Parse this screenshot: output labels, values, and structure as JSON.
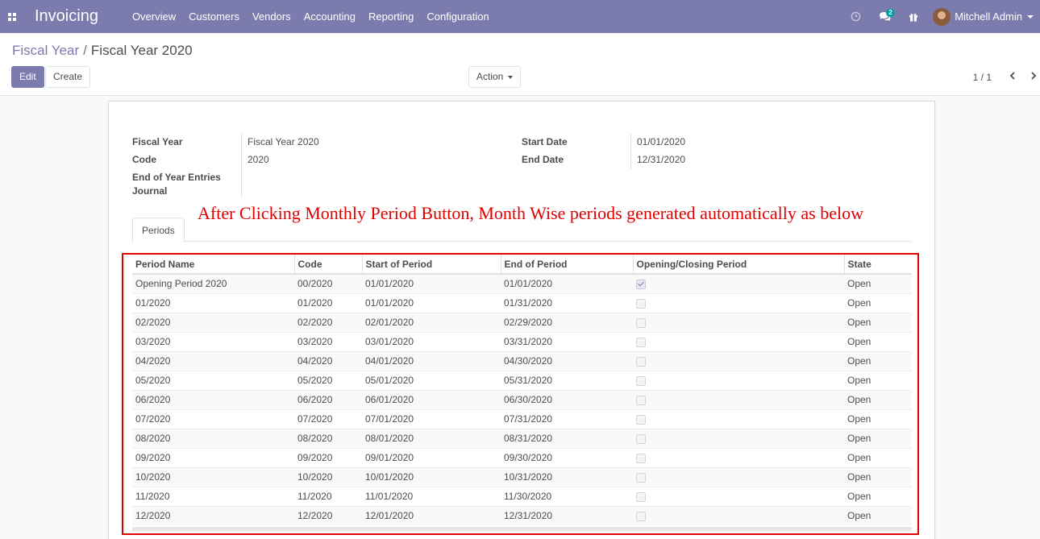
{
  "navbar": {
    "app_title": "Invoicing",
    "menu": [
      "Overview",
      "Customers",
      "Vendors",
      "Accounting",
      "Reporting",
      "Configuration"
    ],
    "messages_badge": "2",
    "user_name": "Mitchell Admin",
    "color": "#7c7bad"
  },
  "breadcrumb": {
    "parent": "Fiscal Year",
    "current": "Fiscal Year 2020"
  },
  "buttons": {
    "edit": "Edit",
    "create": "Create",
    "action": "Action"
  },
  "pager": {
    "text": "1 / 1"
  },
  "form": {
    "fiscal_year_label": "Fiscal Year",
    "fiscal_year_value": "Fiscal Year 2020",
    "code_label": "Code",
    "code_value": "2020",
    "end_entries_label_1": "End of Year Entries",
    "end_entries_label_2": "Journal",
    "start_date_label": "Start Date",
    "start_date_value": "01/01/2020",
    "end_date_label": "End Date",
    "end_date_value": "12/31/2020"
  },
  "annotation": "After Clicking Monthly Period Button, Month Wise periods generated automatically as below",
  "tabs": [
    "Periods"
  ],
  "periods_table": {
    "headers": [
      "Period Name",
      "Code",
      "Start of Period",
      "End of Period",
      "Opening/Closing Period",
      "State"
    ],
    "rows": [
      {
        "name": "Opening Period 2020",
        "code": "00/2020",
        "start": "01/01/2020",
        "end": "01/01/2020",
        "opening": true,
        "state": "Open"
      },
      {
        "name": "01/2020",
        "code": "01/2020",
        "start": "01/01/2020",
        "end": "01/31/2020",
        "opening": false,
        "state": "Open"
      },
      {
        "name": "02/2020",
        "code": "02/2020",
        "start": "02/01/2020",
        "end": "02/29/2020",
        "opening": false,
        "state": "Open"
      },
      {
        "name": "03/2020",
        "code": "03/2020",
        "start": "03/01/2020",
        "end": "03/31/2020",
        "opening": false,
        "state": "Open"
      },
      {
        "name": "04/2020",
        "code": "04/2020",
        "start": "04/01/2020",
        "end": "04/30/2020",
        "opening": false,
        "state": "Open"
      },
      {
        "name": "05/2020",
        "code": "05/2020",
        "start": "05/01/2020",
        "end": "05/31/2020",
        "opening": false,
        "state": "Open"
      },
      {
        "name": "06/2020",
        "code": "06/2020",
        "start": "06/01/2020",
        "end": "06/30/2020",
        "opening": false,
        "state": "Open"
      },
      {
        "name": "07/2020",
        "code": "07/2020",
        "start": "07/01/2020",
        "end": "07/31/2020",
        "opening": false,
        "state": "Open"
      },
      {
        "name": "08/2020",
        "code": "08/2020",
        "start": "08/01/2020",
        "end": "08/31/2020",
        "opening": false,
        "state": "Open"
      },
      {
        "name": "09/2020",
        "code": "09/2020",
        "start": "09/01/2020",
        "end": "09/30/2020",
        "opening": false,
        "state": "Open"
      },
      {
        "name": "10/2020",
        "code": "10/2020",
        "start": "10/01/2020",
        "end": "10/31/2020",
        "opening": false,
        "state": "Open"
      },
      {
        "name": "11/2020",
        "code": "11/2020",
        "start": "11/01/2020",
        "end": "11/30/2020",
        "opening": false,
        "state": "Open"
      },
      {
        "name": "12/2020",
        "code": "12/2020",
        "start": "12/01/2020",
        "end": "12/31/2020",
        "opening": false,
        "state": "Open"
      }
    ]
  }
}
